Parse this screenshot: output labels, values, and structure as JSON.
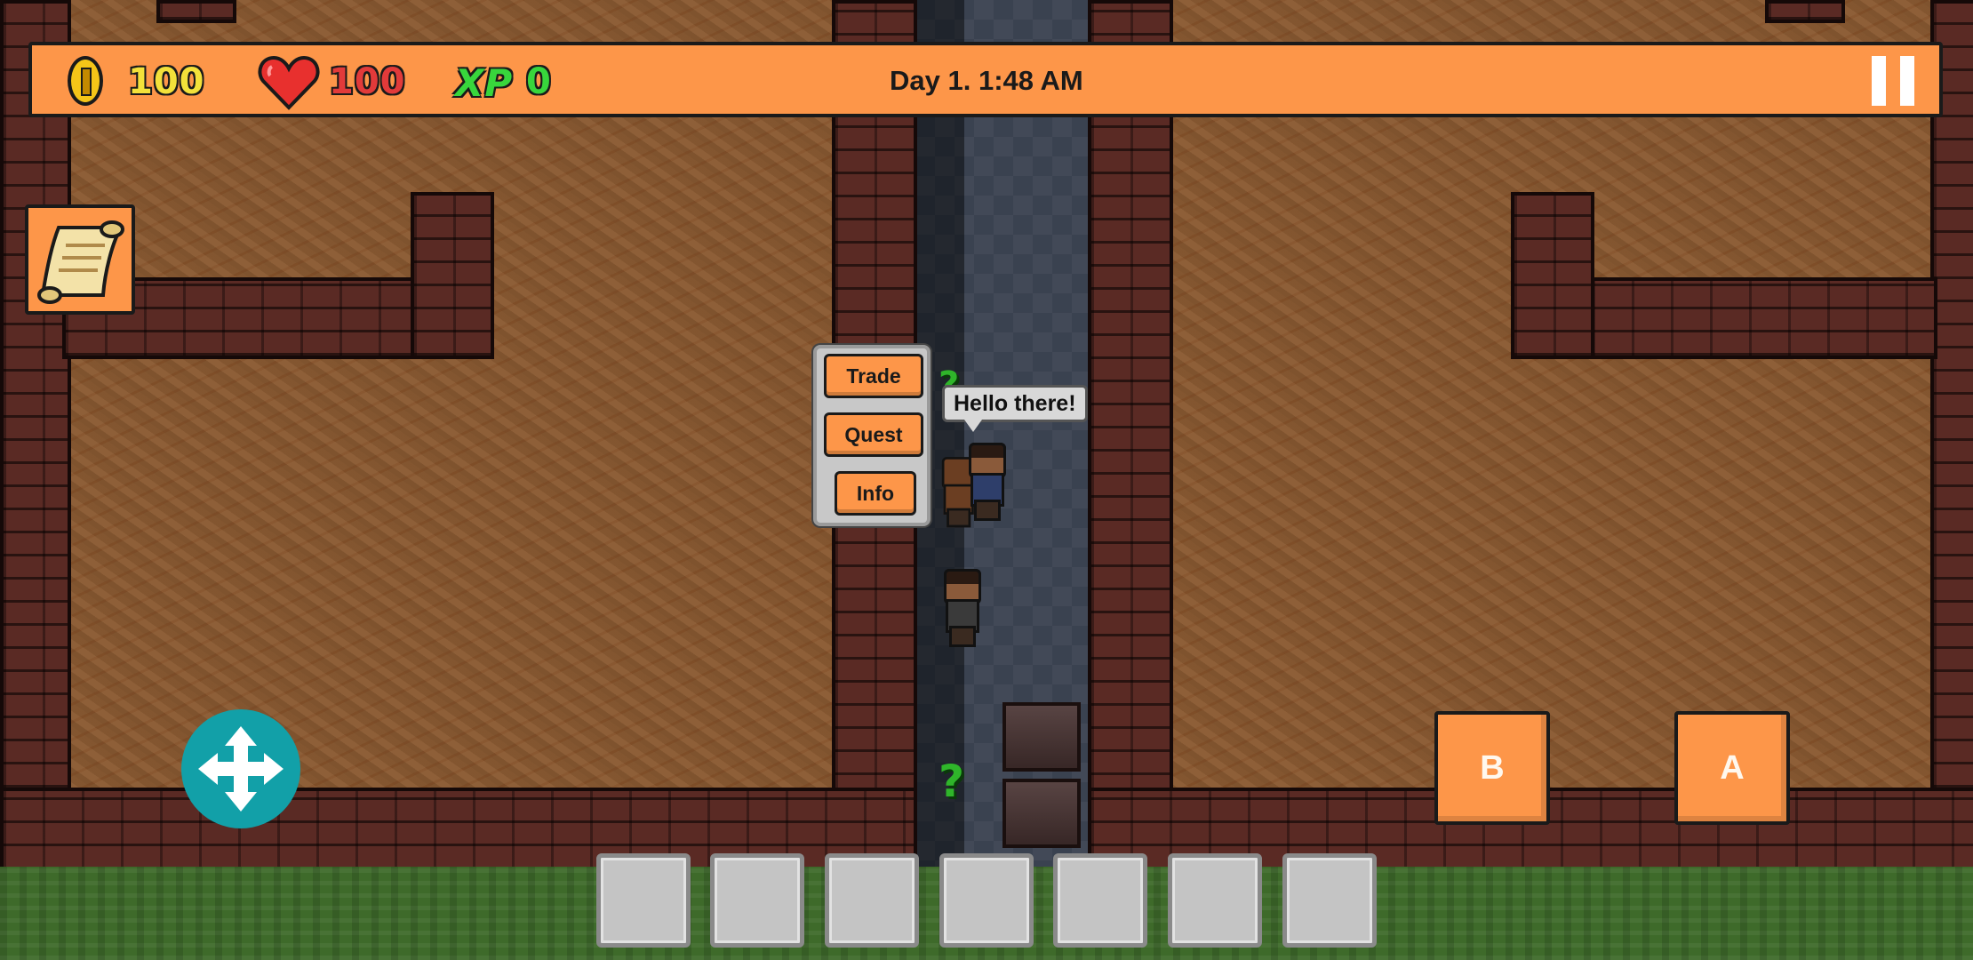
{
  "hud": {
    "coins": "100",
    "health": "100",
    "xp_label": "XP",
    "xp": "0",
    "clock": "Day 1. 1:48 AM"
  },
  "npc_menu": {
    "trade_label": "Trade",
    "quest_label": "Quest",
    "info_label": "Info"
  },
  "speech_bubble": "Hello there!",
  "controls": {
    "b_label": "B",
    "a_label": "A"
  },
  "inventory": {
    "slots": [
      "",
      "",
      "",
      "",
      "",
      "",
      ""
    ]
  },
  "icons": {
    "coin": "coin-icon",
    "health": "heart-icon",
    "pause": "pause-icon",
    "quest_log": "scroll-icon",
    "move": "move-arrows-icon"
  },
  "colors": {
    "hud_orange": "#fd9649",
    "coin_yellow": "#f3e13a",
    "health_red": "#e23a3a",
    "xp_green": "#38d63c",
    "dpad_teal": "#12a0a8"
  }
}
